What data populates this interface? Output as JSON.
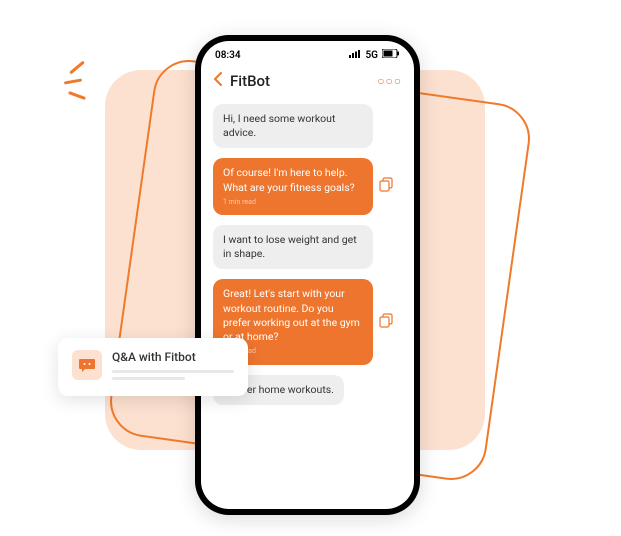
{
  "statusbar": {
    "time": "08:34",
    "network": "5G"
  },
  "header": {
    "title": "FitBot"
  },
  "messages": [
    {
      "role": "user",
      "text": "Hi, I need some workout advice."
    },
    {
      "role": "bot",
      "text": "Of course! I'm here to help. What are your fitness goals?",
      "ts": "1 min read"
    },
    {
      "role": "user",
      "text": "I want to lose weight and get in shape."
    },
    {
      "role": "bot",
      "text": "Great! Let's start with your workout routine. Do you prefer working out at the gym or at home?",
      "ts": "1 min read"
    },
    {
      "role": "user",
      "text": "I prefer home workouts."
    }
  ],
  "card": {
    "title": "Q&A with Fitbot"
  }
}
